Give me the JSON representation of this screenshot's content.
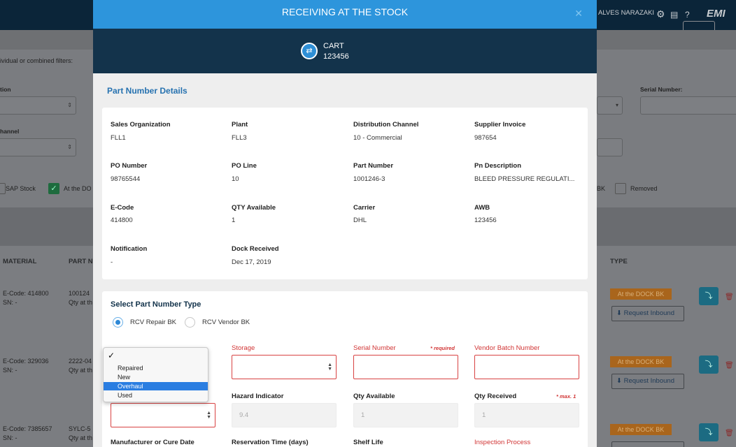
{
  "background": {
    "header": {
      "user": "ALVES NARAZAKI",
      "logo": "EMI"
    },
    "filters_hint": "ividual or combined filters:",
    "label_tion": "tion",
    "label_hannel": "hannel",
    "label_serial": "Serial Number:",
    "check_sap": "SAP Stock",
    "check_dock": "At the DO",
    "label_bk": "BK",
    "check_removed": "Removed",
    "columns": {
      "material": "MATERIAL",
      "partn": "PART N",
      "type": "TYPE"
    },
    "rows": [
      {
        "ecode": "E-Code: 414800",
        "sn": "SN: -",
        "part": "100124",
        "qty": "Qty at th",
        "tag": "At the DOCK BK",
        "action": "Request Inbound"
      },
      {
        "ecode": "E-Code: 329036",
        "sn": "SN: -",
        "part": "2222-04",
        "qty": "Qty at th",
        "tag": "At the DOCK BK",
        "action": "Request Inbound"
      },
      {
        "ecode": "E-Code: 7385657",
        "sn": "SN: -",
        "part": "SYLC-5",
        "qty": "Qty at th",
        "tag": "At the DOCK BK",
        "action": ""
      }
    ]
  },
  "modal": {
    "title": "RECEIVING AT THE STOCK",
    "close_icon": "close-icon",
    "cart": {
      "label": "CART",
      "number": "123456",
      "icon": "swap-icon"
    },
    "section_title": "Part Number Details",
    "details": [
      {
        "label": "Sales Organization",
        "value": "FLL1"
      },
      {
        "label": "Plant",
        "value": "FLL3"
      },
      {
        "label": "Distribution Channel",
        "value": "10 - Commercial"
      },
      {
        "label": "Supplier Invoice",
        "value": "987654"
      },
      {
        "label": "PO Number",
        "value": "98765544"
      },
      {
        "label": "PO Line",
        "value": "10"
      },
      {
        "label": "Part Number",
        "value": "1001246-3"
      },
      {
        "label": "Pn Description",
        "value": "BLEED PRESSURE REGULATI..."
      },
      {
        "label": "E-Code",
        "value": "414800"
      },
      {
        "label": "QTY Available",
        "value": "1"
      },
      {
        "label": "Carrier",
        "value": "DHL"
      },
      {
        "label": "AWB",
        "value": "123456"
      },
      {
        "label": "Notification",
        "value": "-"
      },
      {
        "label": "Dock Received",
        "value": "Dec 17, 2019"
      }
    ],
    "select_title": "Select Part Number Type",
    "radio_repair": "RCV Repair BK",
    "radio_vendor": "RCV Vendor BK",
    "fields": {
      "storage": "Storage",
      "serial": "Serial Number",
      "required": "* required",
      "vendor_batch": "Vendor Batch Number",
      "hazard": "Hazard Indicator",
      "hazard_value": "9.4",
      "qty_available": "Qty Available",
      "qty_available_value": "1",
      "qty_received": "Qty Received",
      "max": "* max. 1",
      "qty_received_value": "1",
      "manufacturer": "Manufacturer or Cure Date",
      "reservation": "Reservation Time (days)",
      "shelf": "Shelf Life",
      "inspection": "Inspection Process"
    },
    "dropdown": {
      "selected_mark": "✓",
      "options": [
        "Repaired",
        "New",
        "Overhaul",
        "Used"
      ],
      "highlighted": "Overhaul"
    }
  }
}
